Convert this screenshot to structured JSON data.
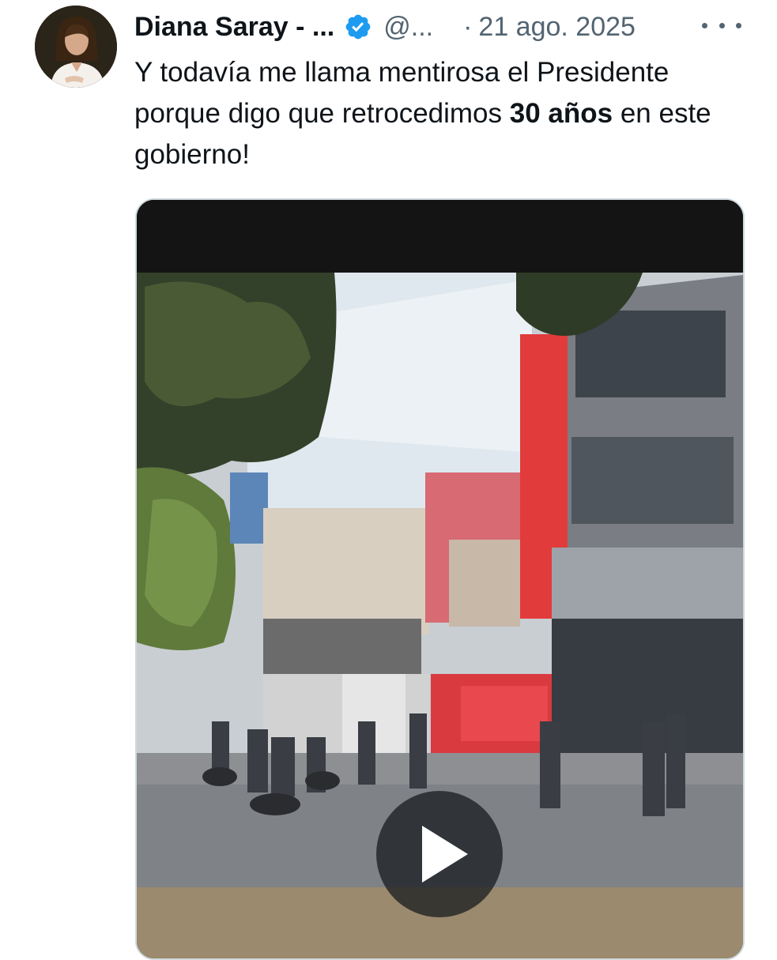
{
  "tweet": {
    "display_name": "Diana Saray - ...",
    "handle": "@...",
    "separator": "·",
    "date": "21 ago. 2025",
    "text_before": "Y todavía me llama mentirosa el Presidente porque digo que retrocedimos ",
    "text_bold": "30 años",
    "text_after": " en este gobierno!"
  },
  "icons": {
    "verified": "verified-badge-icon",
    "more": "more-options-icon",
    "play": "play-icon"
  },
  "colors": {
    "verified_blue": "#1d9bf0",
    "secondary_text": "#536471",
    "primary_text": "#0f1419"
  }
}
